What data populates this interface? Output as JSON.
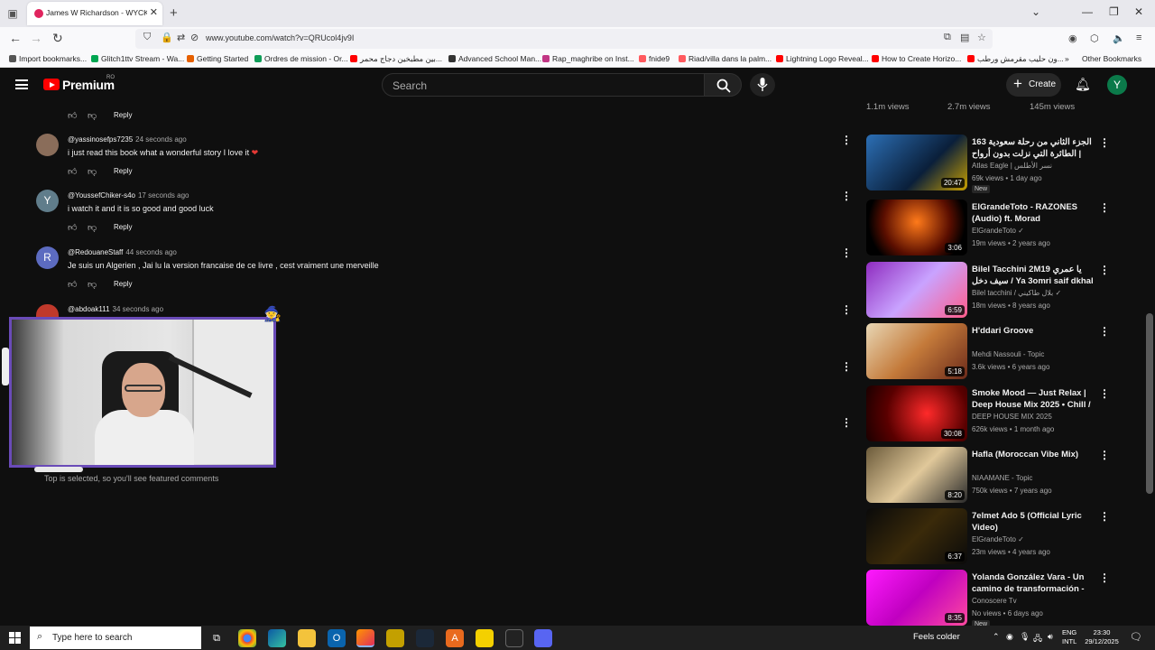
{
  "browser": {
    "tab_title": "James W Richardson - WYCKEL",
    "url": "www.youtube.com/watch?v=QRUcol4jv9I",
    "bookmarks": [
      {
        "label": "Import bookmarks...",
        "color": "#555555"
      },
      {
        "label": "Glitch1ttv Stream - Wa...",
        "color": "#00a651"
      },
      {
        "label": "Getting Started",
        "color": "#e66000"
      },
      {
        "label": "Ordres de mission - Or...",
        "color": "#0f9d58"
      },
      {
        "label": "بين مطبخين دجاج محمر...",
        "color": "#ff0000"
      },
      {
        "label": "Advanced School Man...",
        "color": "#333333"
      },
      {
        "label": "Rap_maghribe on Inst...",
        "color": "#c13584"
      },
      {
        "label": "fnide9",
        "color": "#ff5a5f"
      },
      {
        "label": "Riad/villa dans la palm...",
        "color": "#ff5a5f"
      },
      {
        "label": "Lightning Logo Reveal...",
        "color": "#ff0000"
      },
      {
        "label": "How to Create Horizo...",
        "color": "#ff0000"
      },
      {
        "label": "ون حليب مقرمش ورطب...",
        "color": "#ff0000"
      }
    ],
    "other_bookmarks": "Other Bookmarks"
  },
  "youtube": {
    "brand": "Premium",
    "region": "RO",
    "search_placeholder": "Search",
    "create_label": "Create",
    "avatar_letter": "Y"
  },
  "comments": [
    {
      "user": "@yassinosefps7235",
      "time": "24 seconds ago",
      "text": "i just read this book what a wonderful story I love it",
      "avatar_letter": "",
      "avatar_color": "#8a6d5a",
      "heart": true
    },
    {
      "user": "@YoussefChiker-s4o",
      "time": "17 seconds ago",
      "text": "i watch it and it is so good and good luck",
      "avatar_letter": "Y",
      "avatar_color": "#607d8b",
      "heart": false
    },
    {
      "user": "@RedouaneStaff",
      "time": "44 seconds ago",
      "text": "Je suis un Algerien , Jai lu la version francaise de ce livre , cest vraiment une merveille",
      "avatar_letter": "R",
      "avatar_color": "#5c6bc0",
      "heart": false
    },
    {
      "user": "@abdoak111",
      "time": "34 seconds ago",
      "text": "",
      "avatar_letter": "a",
      "avatar_color": "#c0392b",
      "heart": false
    }
  ],
  "comment_reply_label": "Reply",
  "featured_note": "Top is selected, so you'll see featured comments",
  "sidebar_views_row": [
    "1.1m views",
    "2.7m views",
    "145m views"
  ],
  "videos": [
    {
      "title": "الجزء الثاني من رحلة سعودية 163 | الطائرة التي نزلت بدون أرواح",
      "channel": "Atlas Eagle | نسر الأطلس",
      "meta": "69k views • 1 day ago",
      "duration": "20:47",
      "badge": "New",
      "thumb": "linear-gradient(135deg,#2c6fb5,#0a1f3a 60%,#c8a000)"
    },
    {
      "title": "ElGrandeToto - RAZONES (Audio) ft. Morad",
      "channel": "ElGrandeToto ✓",
      "meta": "19m views • 2 years ago",
      "duration": "3:06",
      "badge": "",
      "thumb": "radial-gradient(circle at 50% 40%,#ff7a1a,#5a0e00 55%,#000 80%)"
    },
    {
      "title": "Bilel Tacchini 2M19 يا عمري سيف دخل / Ya 3omri saif dkhal",
      "channel": "Bilel tacchini / بلال طاكيني ✓",
      "meta": "18m views • 8 years ago",
      "duration": "6:59",
      "badge": "",
      "thumb": "linear-gradient(135deg,#8e2bbf,#c9a3ff 50%,#ff5c8a)"
    },
    {
      "title": "H'ddari Groove",
      "channel": "Mehdi Nassouli - Topic",
      "meta": "3.6k views • 6 years ago",
      "duration": "5:18",
      "badge": "",
      "thumb": "linear-gradient(135deg,#e8d7b5,#c47a3a 50%,#6b2a1a)"
    },
    {
      "title": "Smoke Mood — Just Relax | Deep House Mix 2025 • Chill / ...",
      "channel": "DEEP HOUSE MIX 2025",
      "meta": "626k views • 1 month ago",
      "duration": "30:08",
      "badge": "",
      "thumb": "radial-gradient(circle at 60% 50%,#ff2a2a,#5a0000 60%,#1a0000)"
    },
    {
      "title": "Hafla (Moroccan Vibe Mix)",
      "channel": "NIAAMANE - Topic",
      "meta": "750k views • 7 years ago",
      "duration": "8:20",
      "badge": "",
      "thumb": "linear-gradient(135deg,#6b5a3a,#e0c89a 50%,#2a2a2a)"
    },
    {
      "title": "7elmet Ado 5 (Official Lyric Video)",
      "channel": "ElGrandeToto ✓",
      "meta": "23m views • 4 years ago",
      "duration": "6:37",
      "badge": "",
      "thumb": "linear-gradient(135deg,#0a0a0a,#3a2a0a 50%,#0a0a0a)"
    },
    {
      "title": "Yolanda González Vara - Un camino de transformación - ...",
      "channel": "Conoscere Tv",
      "meta": "No views • 6 days ago",
      "duration": "8:35",
      "badge": "New",
      "thumb": "linear-gradient(135deg,#ff1aff,#c000c0 50%,#ff4aa0)"
    }
  ],
  "taskbar": {
    "search_placeholder": "Type here to search",
    "weather": "Feels colder",
    "lang_line1": "ENG",
    "lang_line2": "INTL",
    "time": "23:30",
    "date": "29/12/2025"
  }
}
